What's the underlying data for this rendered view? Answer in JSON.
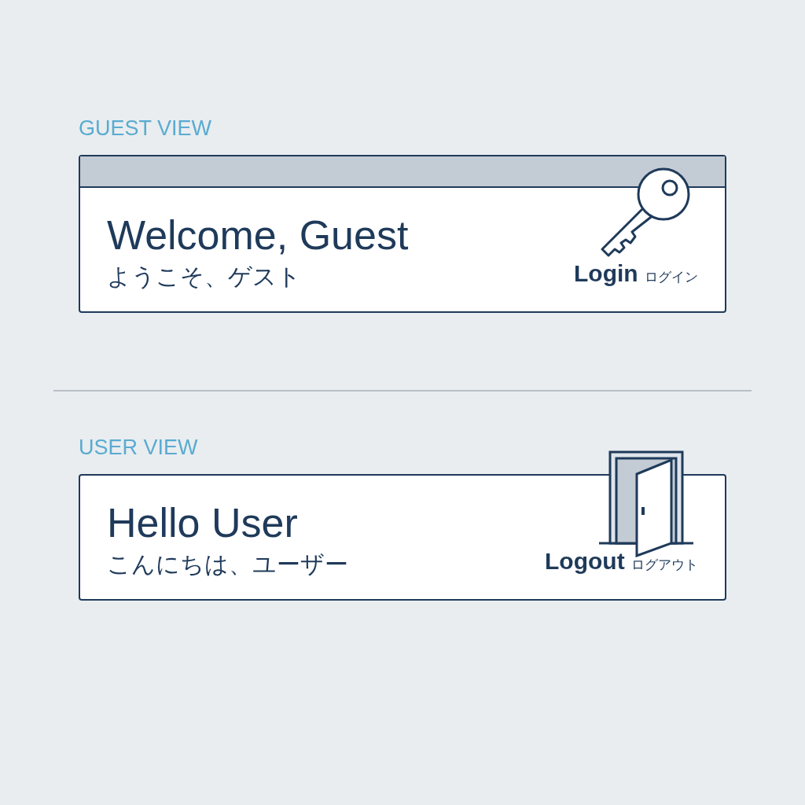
{
  "sections": [
    {
      "kind": "guest",
      "label": "GUEST VIEW",
      "title": "Welcome, Guest",
      "subtitle": "ようこそ、ゲスト",
      "action": {
        "label": "Login",
        "label_ja": "ログイン"
      }
    },
    {
      "kind": "user",
      "label": "USER VIEW",
      "title": "Hello User",
      "subtitle": "こんにちは、ユーザー",
      "action": {
        "label": "Logout",
        "label_ja": "ログアウト"
      }
    }
  ]
}
